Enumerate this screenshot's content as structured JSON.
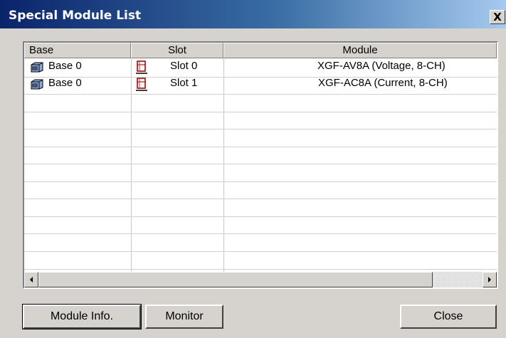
{
  "window": {
    "title": "Special Module List",
    "close_glyph": "X"
  },
  "table": {
    "columns": [
      "Base",
      "Slot",
      "Module"
    ],
    "rows": [
      {
        "base": "Base 0",
        "slot": "Slot 0",
        "module": "XGF-AV8A (Voltage, 8-CH)"
      },
      {
        "base": "Base 0",
        "slot": "Slot 1",
        "module": "XGF-AC8A (Current, 8-CH)"
      }
    ]
  },
  "icons": {
    "base": "base-module-icon",
    "slot": "slot-icon"
  },
  "buttons": {
    "module_info": "Module Info.",
    "monitor": "Monitor",
    "close": "Close"
  }
}
